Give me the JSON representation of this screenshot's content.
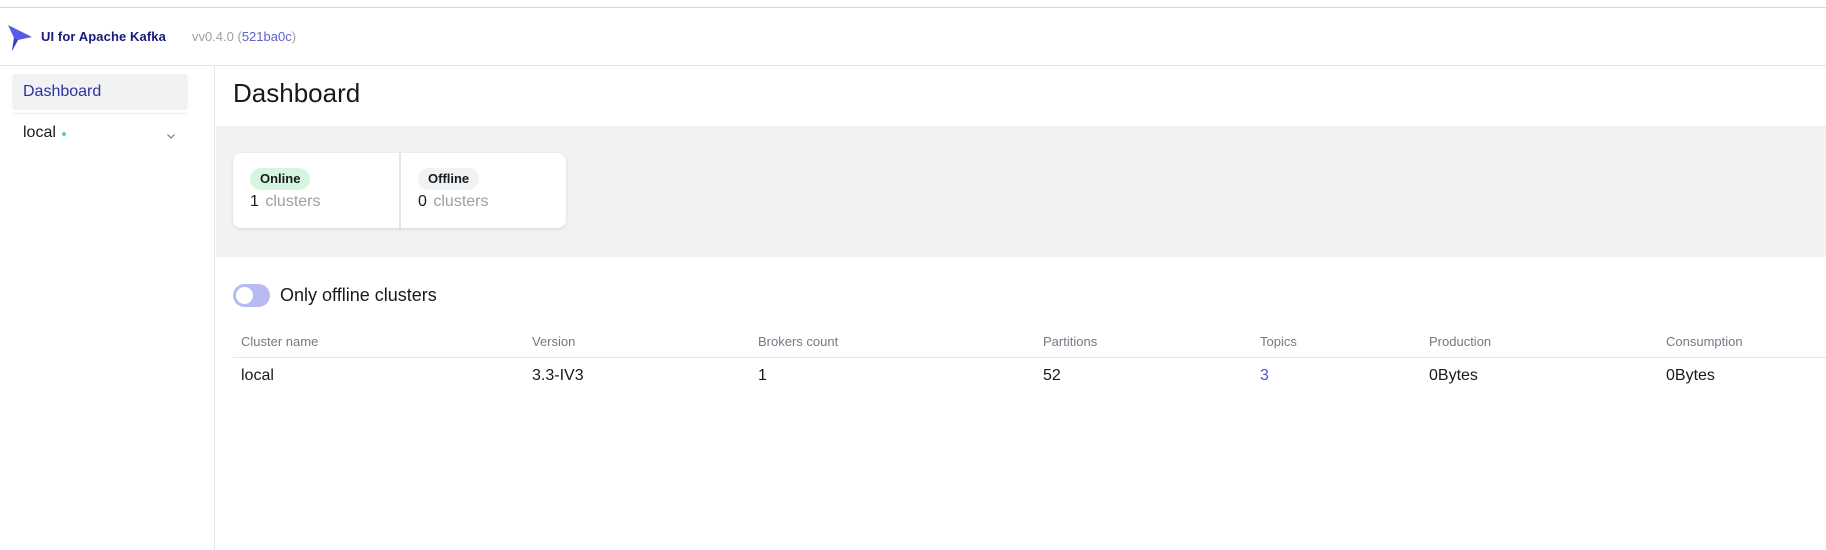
{
  "app": {
    "title": "UI for Apache Kafka",
    "version_prefix": "vv0.4.0 (",
    "commit": "521ba0c",
    "version_suffix": ")"
  },
  "sidebar": {
    "items": [
      {
        "label": "Dashboard",
        "active": true
      },
      {
        "label": "local",
        "status": "online",
        "expandable": true
      }
    ]
  },
  "page": {
    "title": "Dashboard"
  },
  "stats": {
    "online": {
      "badge": "Online",
      "count": "1",
      "unit": "clusters"
    },
    "offline": {
      "badge": "Offline",
      "count": "0",
      "unit": "clusters"
    }
  },
  "filter": {
    "label": "Only offline clusters",
    "enabled": false
  },
  "table": {
    "headers": [
      "Cluster name",
      "Version",
      "Brokers count",
      "Partitions",
      "Topics",
      "Production",
      "Consumption"
    ],
    "rows": [
      [
        "local",
        "3.3-IV3",
        "1",
        "52",
        "3",
        "0Bytes",
        "0Bytes"
      ]
    ]
  },
  "colors": {
    "accent": "#4f4ff0",
    "online_badge": "#d6f5e0",
    "status_dot": "#5cd685",
    "toggle": "#b7bbf0"
  },
  "icons": {
    "logo": "kafka-ui-logo-icon",
    "expand": "chevron-down-icon"
  }
}
